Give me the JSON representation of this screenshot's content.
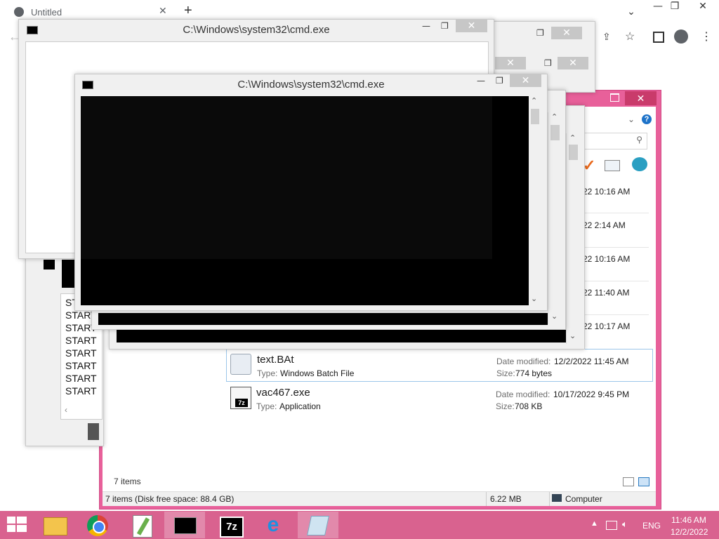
{
  "browser": {
    "tab_title": "Untitled",
    "new_tab": "+",
    "controls": {
      "minimize": "—",
      "maximize": "❐",
      "close": "✕",
      "chevron": "⌄"
    }
  },
  "cmd_back": {
    "title": "C:\\Windows\\system32\\cmd.exe"
  },
  "cmd_front": {
    "title": "C:\\Windows\\system32\\cmd.exe"
  },
  "left_panel": {
    "lines": [
      "ST",
      "START",
      "START",
      "START",
      "START",
      "START",
      "START",
      "START"
    ]
  },
  "explorer": {
    "times": [
      "22 10:16 AM",
      "22 2:14 AM",
      "22 10:16 AM",
      "22 11:40 AM",
      "22 10:17 AM"
    ],
    "files": [
      {
        "name": "text.BAt",
        "type_label": "Type:",
        "type_value": "Windows Batch File",
        "date_label": "Date modified:",
        "date_value": "12/2/2022 11:45 AM",
        "size_label": "Size:",
        "size_value": "774 bytes"
      },
      {
        "name": "vac467.exe",
        "type_label": "Type:",
        "type_value": "Application",
        "date_label": "Date modified:",
        "date_value": "10/17/2022 9:45 PM",
        "size_label": "Size:",
        "size_value": "708 KB"
      }
    ],
    "items_count": "7 items",
    "status": {
      "left": "7 items (Disk free space: 88.4 GB)",
      "size": "6.22 MB",
      "location": "Computer"
    }
  },
  "taskbar": {
    "lang": "ENG",
    "time": "11:46 AM",
    "date": "12/2/2022",
    "icons": [
      "windows-start",
      "file-explorer",
      "chrome",
      "notepad-plus",
      "cmd",
      "7zip",
      "internet-explorer",
      "app-blue"
    ]
  }
}
